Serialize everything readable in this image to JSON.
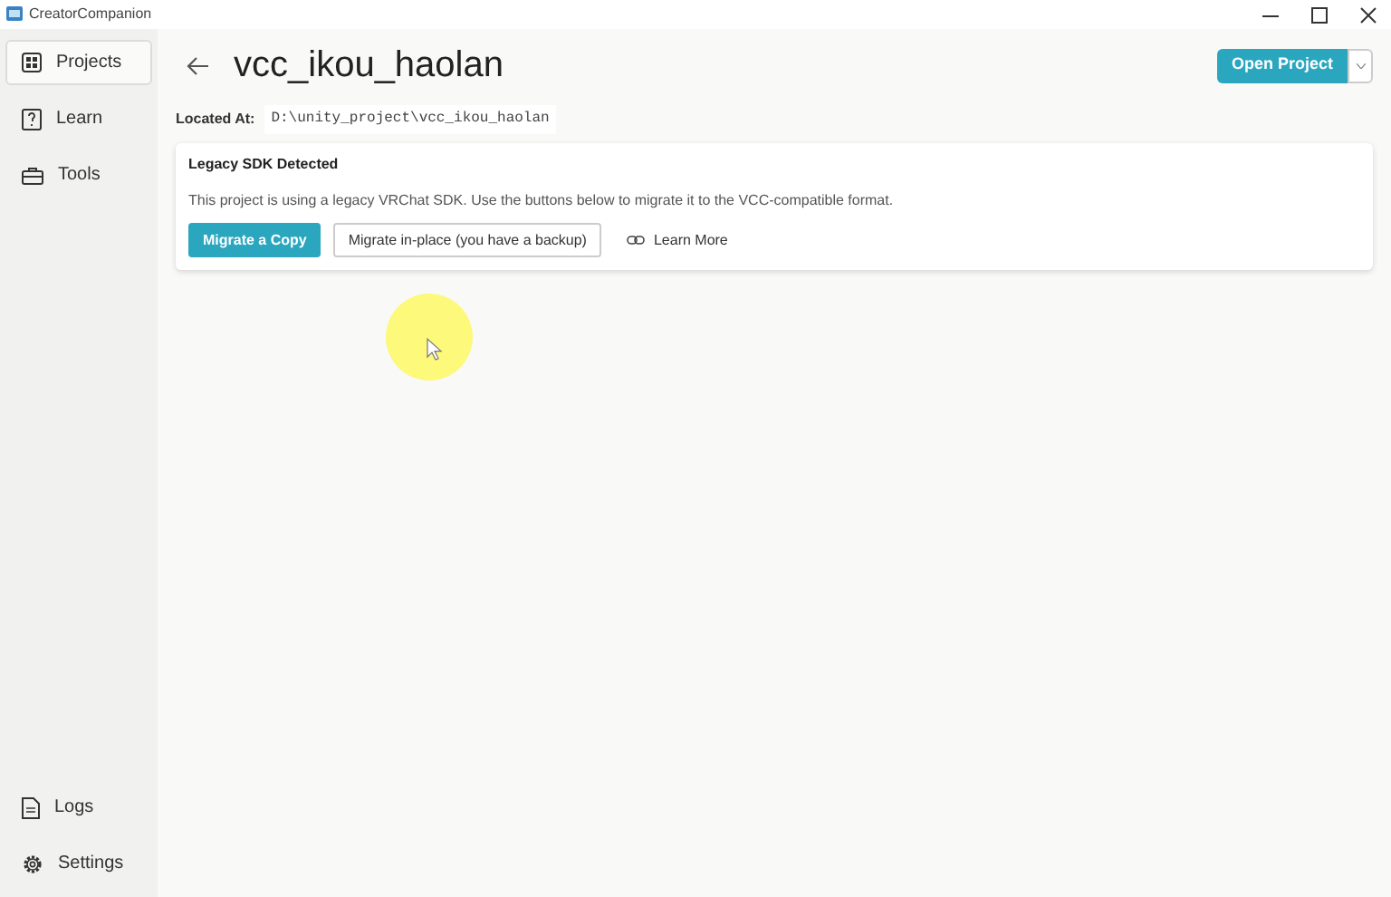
{
  "window": {
    "title": "CreatorCompanion"
  },
  "sidebar": {
    "items": [
      {
        "kind": "projects",
        "label": "Projects",
        "selected": true
      },
      {
        "kind": "learn",
        "label": "Learn",
        "selected": false
      },
      {
        "kind": "tools",
        "label": "Tools",
        "selected": false
      }
    ],
    "bottom_items": [
      {
        "kind": "logs",
        "label": "Logs",
        "selected": false
      },
      {
        "kind": "settings",
        "label": "Settings",
        "selected": false
      }
    ]
  },
  "header": {
    "title": "vcc_ikou_haolan",
    "open_button": "Open Project"
  },
  "location": {
    "label": "Located At:",
    "path": "D:\\unity_project\\vcc_ikou_haolan"
  },
  "alert": {
    "title": "Legacy SDK Detected",
    "message": "This project is using a legacy VRChat SDK. Use the buttons below to migrate it to the VCC-compatible format.",
    "buttons": [
      {
        "kind": "primary",
        "label": "Migrate a Copy"
      },
      {
        "kind": "outline",
        "label": "Migrate in-place (you have a backup)"
      },
      {
        "kind": "link",
        "label": "Learn More"
      }
    ]
  }
}
